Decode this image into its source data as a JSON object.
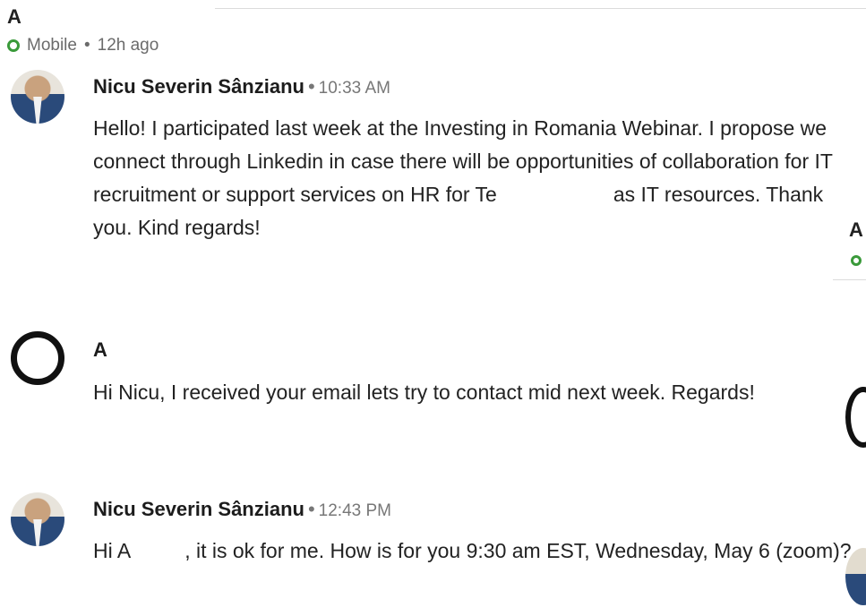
{
  "header": {
    "name": "A",
    "status": "Mobile",
    "status_sep": "•",
    "last_seen": "12h ago"
  },
  "messages": [
    {
      "sender": "Nicu Severin Sânzianu",
      "time": "10:33 AM",
      "text_before": "Hello! I participated last week at the Investing in Romania Webinar. I propose we connect through Linkedin in case there will be opportunities of collaboration for IT recruitment or support services on HR for Te",
      "text_after": "as IT resources. Thank you. Kind regards!"
    },
    {
      "sender": "A",
      "time": "",
      "text": "Hi Nicu, I received your email lets try to contact mid next week. Regards!"
    },
    {
      "sender": "Nicu Severin Sânzianu",
      "time": "12:43 PM",
      "text_before": "Hi A",
      "text_after": ", it is ok for me. How is for you 9:30 am EST, Wednesday, May 6 (zoom)?"
    }
  ],
  "edge_panel": {
    "initial": "A"
  },
  "colors": {
    "online": "#3a9a3a",
    "muted_text": "#777777"
  }
}
